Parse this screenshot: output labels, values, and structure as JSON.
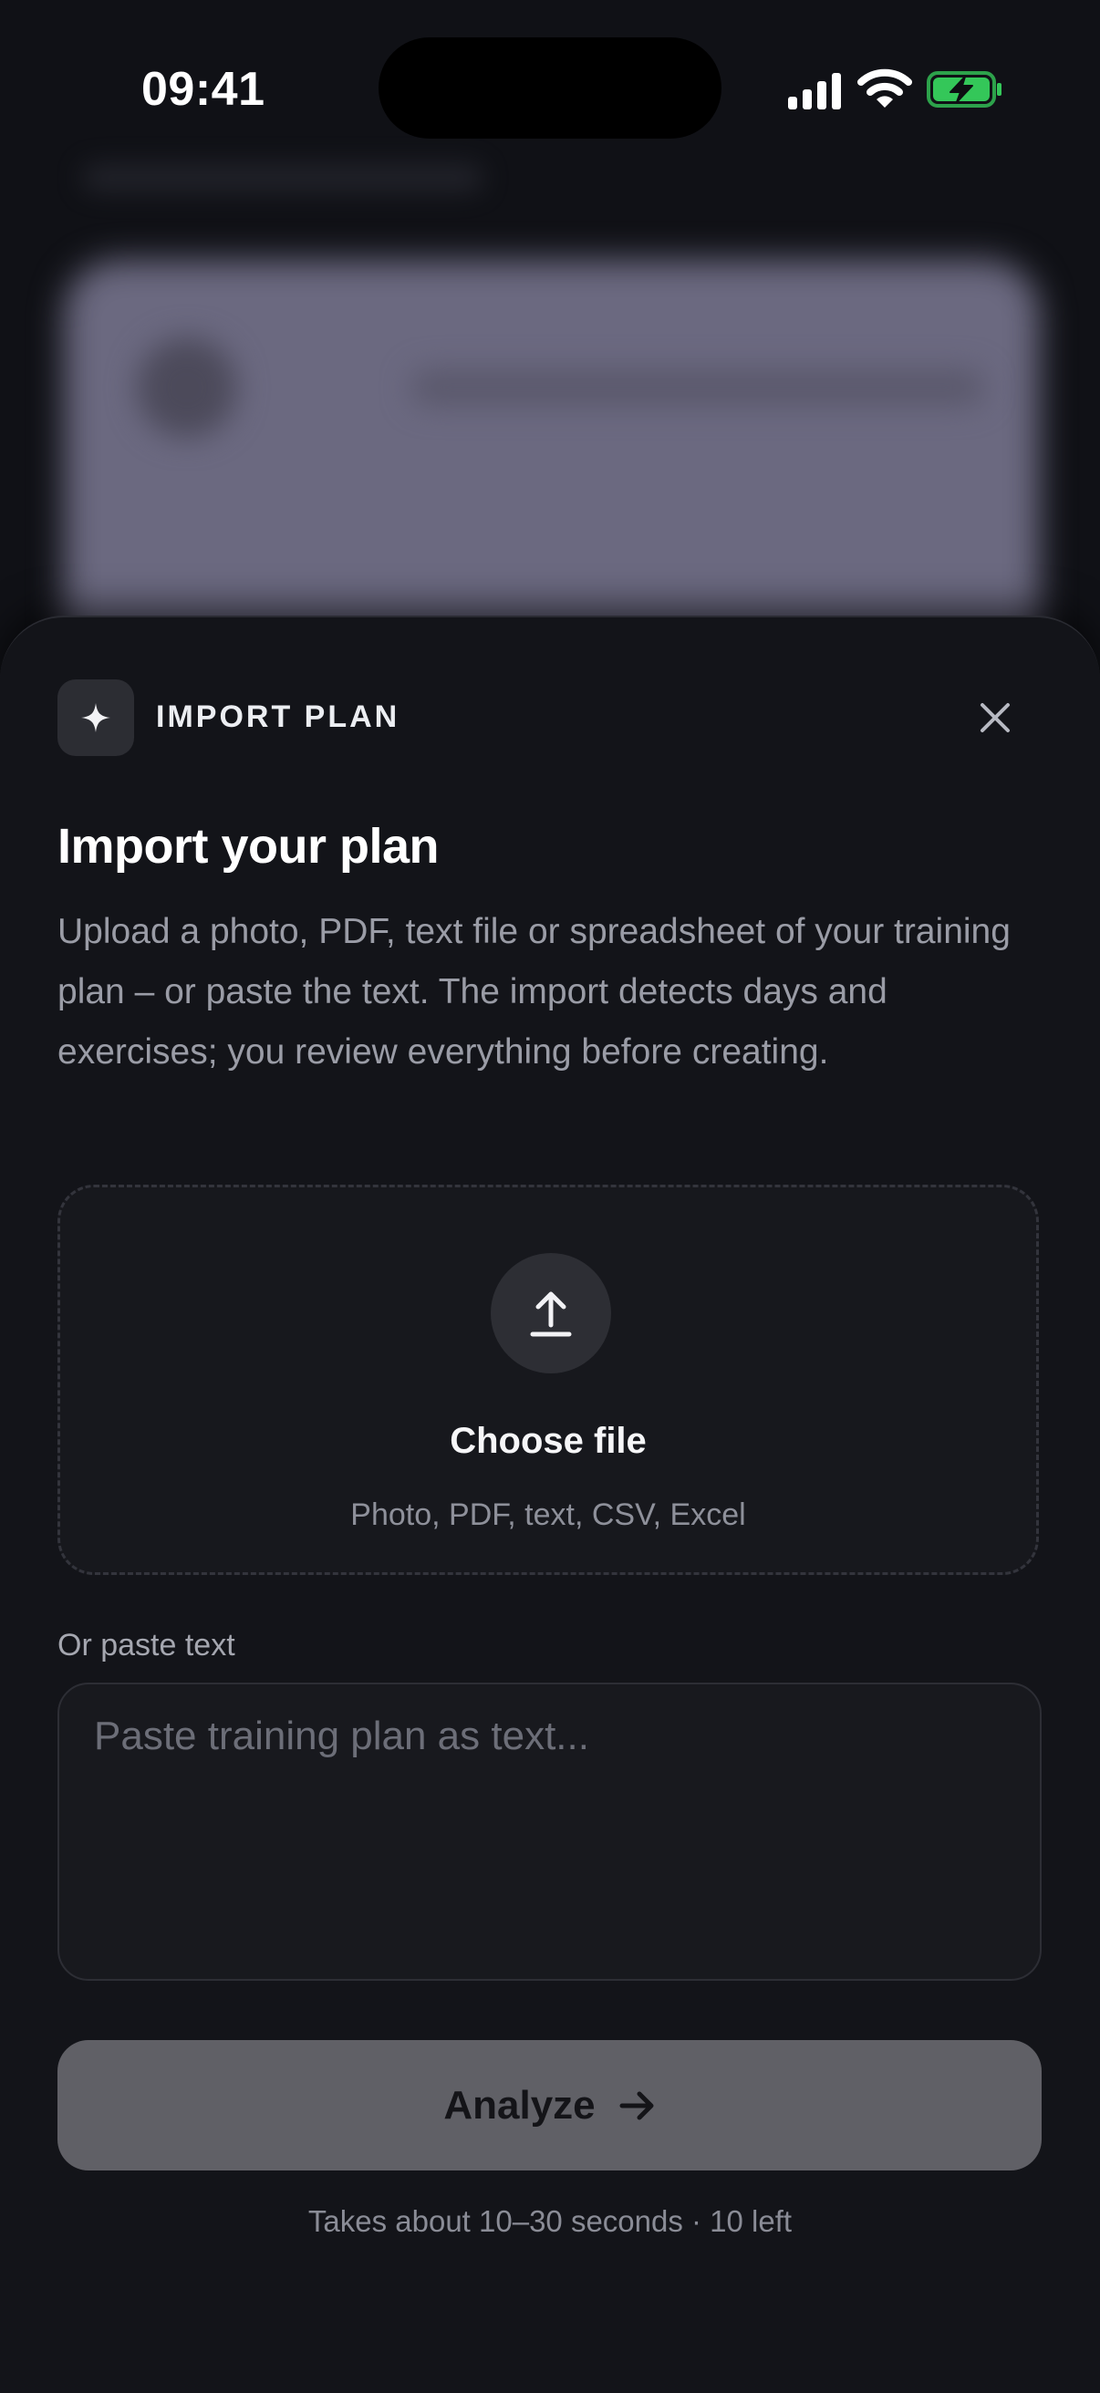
{
  "status_bar": {
    "time": "09:41",
    "icons": [
      "signal-icon",
      "wifi-icon",
      "battery-charging-icon"
    ],
    "battery_color": "#34c759"
  },
  "sheet": {
    "kicker": "IMPORT PLAN",
    "kicker_icon": "sparkle-icon",
    "close_icon": "close-icon",
    "title": "Import your plan",
    "description": "Upload a photo, PDF, text file or spreadsheet of your training plan – or paste the text. The import detects days and exercises; you review everything before creating.",
    "dropzone": {
      "icon": "upload-icon",
      "title": "Choose file",
      "subtitle": "Photo, PDF, text, CSV, Excel"
    },
    "paste": {
      "label": "Or paste text",
      "value": "",
      "placeholder": "Paste training plan as text..."
    },
    "analyze_button": {
      "label": "Analyze",
      "icon": "arrow-right-icon",
      "enabled": false
    },
    "footnote": "Takes about 10–30 seconds · 10 left"
  },
  "colors": {
    "sheet_background": "#131419",
    "button_disabled": "#606066",
    "text_primary": "#ffffff",
    "text_secondary": "#9a9ca6"
  }
}
